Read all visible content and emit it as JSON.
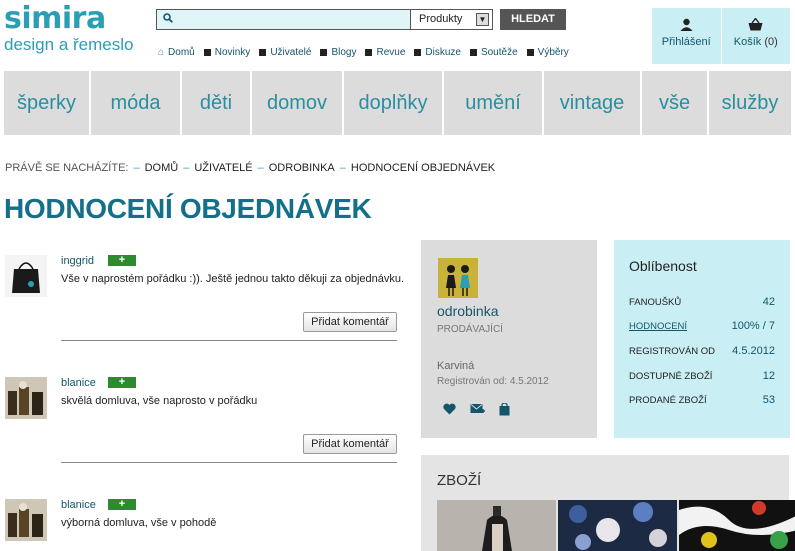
{
  "logo": {
    "line1": "simira",
    "line2": "design a řemeslo"
  },
  "search": {
    "value": "",
    "placeholder": "",
    "select": "Produkty",
    "button": "HLEDAT"
  },
  "topnav": [
    "Domů",
    "Novinky",
    "Uživatelé",
    "Blogy",
    "Revue",
    "Diskuze",
    "Soutěže",
    "Výběry"
  ],
  "user": {
    "login": "Přihlášení",
    "cart": "Košík",
    "cart_count": "(0)"
  },
  "categories": [
    "šperky",
    "móda",
    "děti",
    "domov",
    "doplňky",
    "umění",
    "vintage",
    "vše",
    "služby"
  ],
  "breadcrumb": {
    "label": "PRÁVĚ SE NACHÁZÍTE:",
    "items": [
      "DOMŮ",
      "UŽIVATELÉ",
      "ODROBINKA",
      "HODNOCENÍ OBJEDNÁVEK"
    ]
  },
  "title": "HODNOCENÍ OBJEDNÁVEK",
  "reviews": [
    {
      "user": "inggrid",
      "plus": "+",
      "text": "Vše v naprostém pořádku :)). Ještě jednou takto děkuji za objednávku.",
      "button": "Přidat komentář"
    },
    {
      "user": "blanice",
      "plus": "+",
      "text": "skvělá domluva, vše naprosto v pořádku",
      "button": "Přidat komentář"
    },
    {
      "user": "blanice",
      "plus": "+",
      "text": "výborná domluva, vše v pohodě",
      "button": ""
    }
  ],
  "seller": {
    "name": "odrobinka",
    "role": "PRODÁVAJÍCÍ",
    "city": "Karviná",
    "registered": "Registrován od: 4.5.2012"
  },
  "popularity": {
    "heading": "Oblíbenost",
    "rows": [
      {
        "key": "FANOUŠKŮ",
        "value": "42"
      },
      {
        "key": "HODNOCENÍ",
        "value": "100% / 7"
      },
      {
        "key": "REGISTROVÁN OD",
        "value": "4.5.2012"
      },
      {
        "key": "DOSTUPNÉ ZBOŽÍ",
        "value": "12"
      },
      {
        "key": "PRODANÉ ZBOŽÍ",
        "value": "53"
      }
    ]
  },
  "goods": {
    "heading": "ZBOŽÍ"
  },
  "colors": {
    "accent": "#2a9fb4",
    "link": "#14556b",
    "catbar": "#dcdcdc",
    "lightblue": "#c9eef3",
    "plus_badge": "#2e8a2e"
  }
}
